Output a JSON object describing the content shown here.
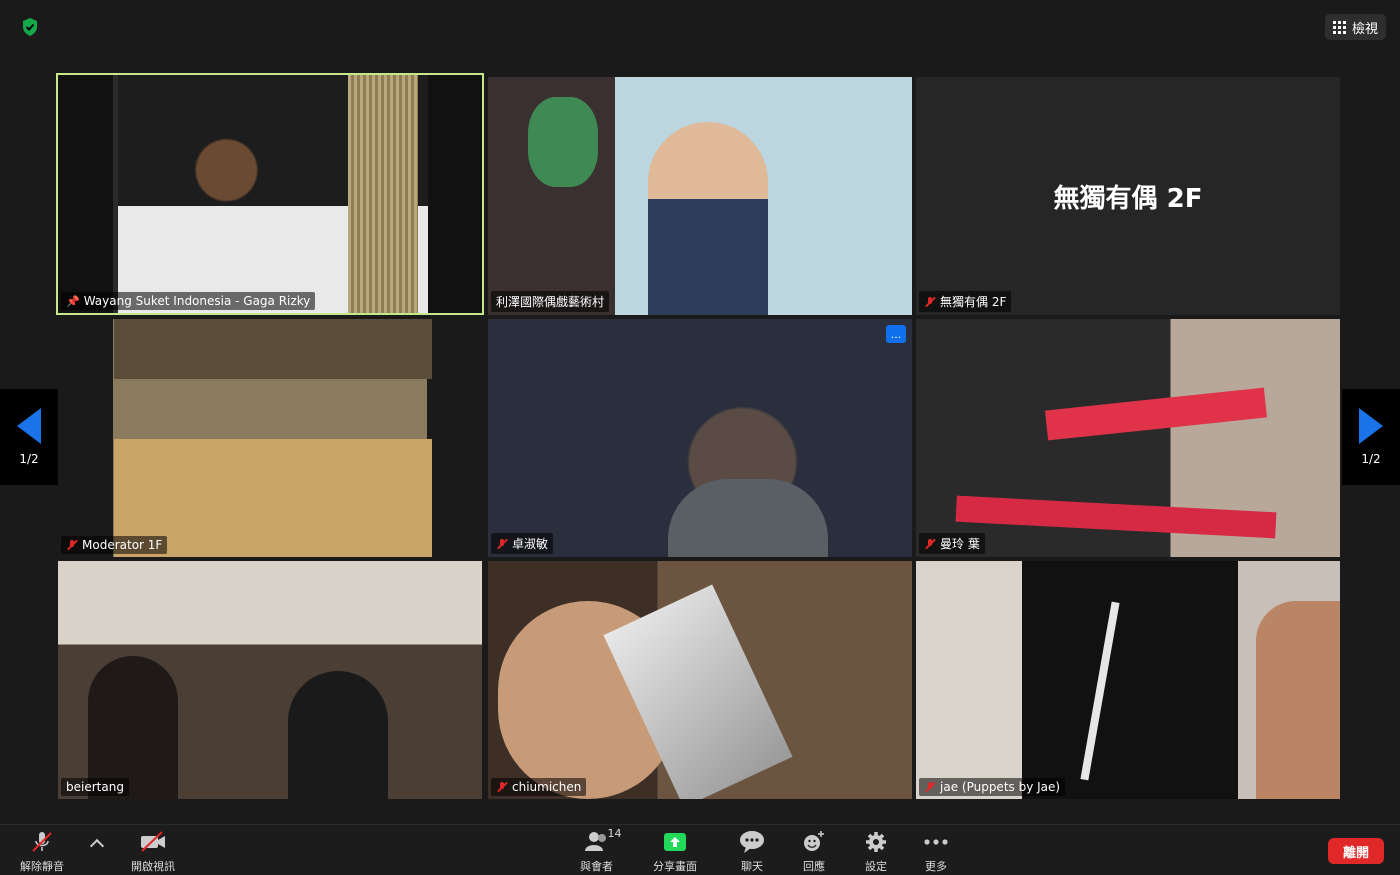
{
  "top": {
    "view_label": "檢視"
  },
  "pager": {
    "left_label": "1/2",
    "right_label": "1/2"
  },
  "tiles": [
    {
      "name": "Wayang Suket Indonesia - Gaga Rizky",
      "status": "pinned",
      "active": true
    },
    {
      "name": "利澤國際偶戲藝術村",
      "status": "none"
    },
    {
      "name": "無獨有偶 2F",
      "status": "muted",
      "display_name": "無獨有偶 2F"
    },
    {
      "name": "Moderator 1F",
      "status": "muted"
    },
    {
      "name": "卓淑敏",
      "status": "muted",
      "menu": "..."
    },
    {
      "name": "曼玲 葉",
      "status": "muted"
    },
    {
      "name": "beiertang",
      "status": "none"
    },
    {
      "name": "chiumichen",
      "status": "muted"
    },
    {
      "name": "jae (Puppets by Jae)",
      "status": "muted"
    }
  ],
  "toolbar": {
    "unmute": "解除靜音",
    "start_video": "開啟視訊",
    "participants": "與會者",
    "participants_count": "14",
    "share_screen": "分享畫面",
    "chat": "聊天",
    "reactions": "回應",
    "settings": "設定",
    "more": "更多",
    "leave": "離開"
  },
  "colors": {
    "active_border": "#c5e88b",
    "accent_blue": "#1a73e8",
    "share_green": "#23d959",
    "leave_red": "#e02828"
  }
}
